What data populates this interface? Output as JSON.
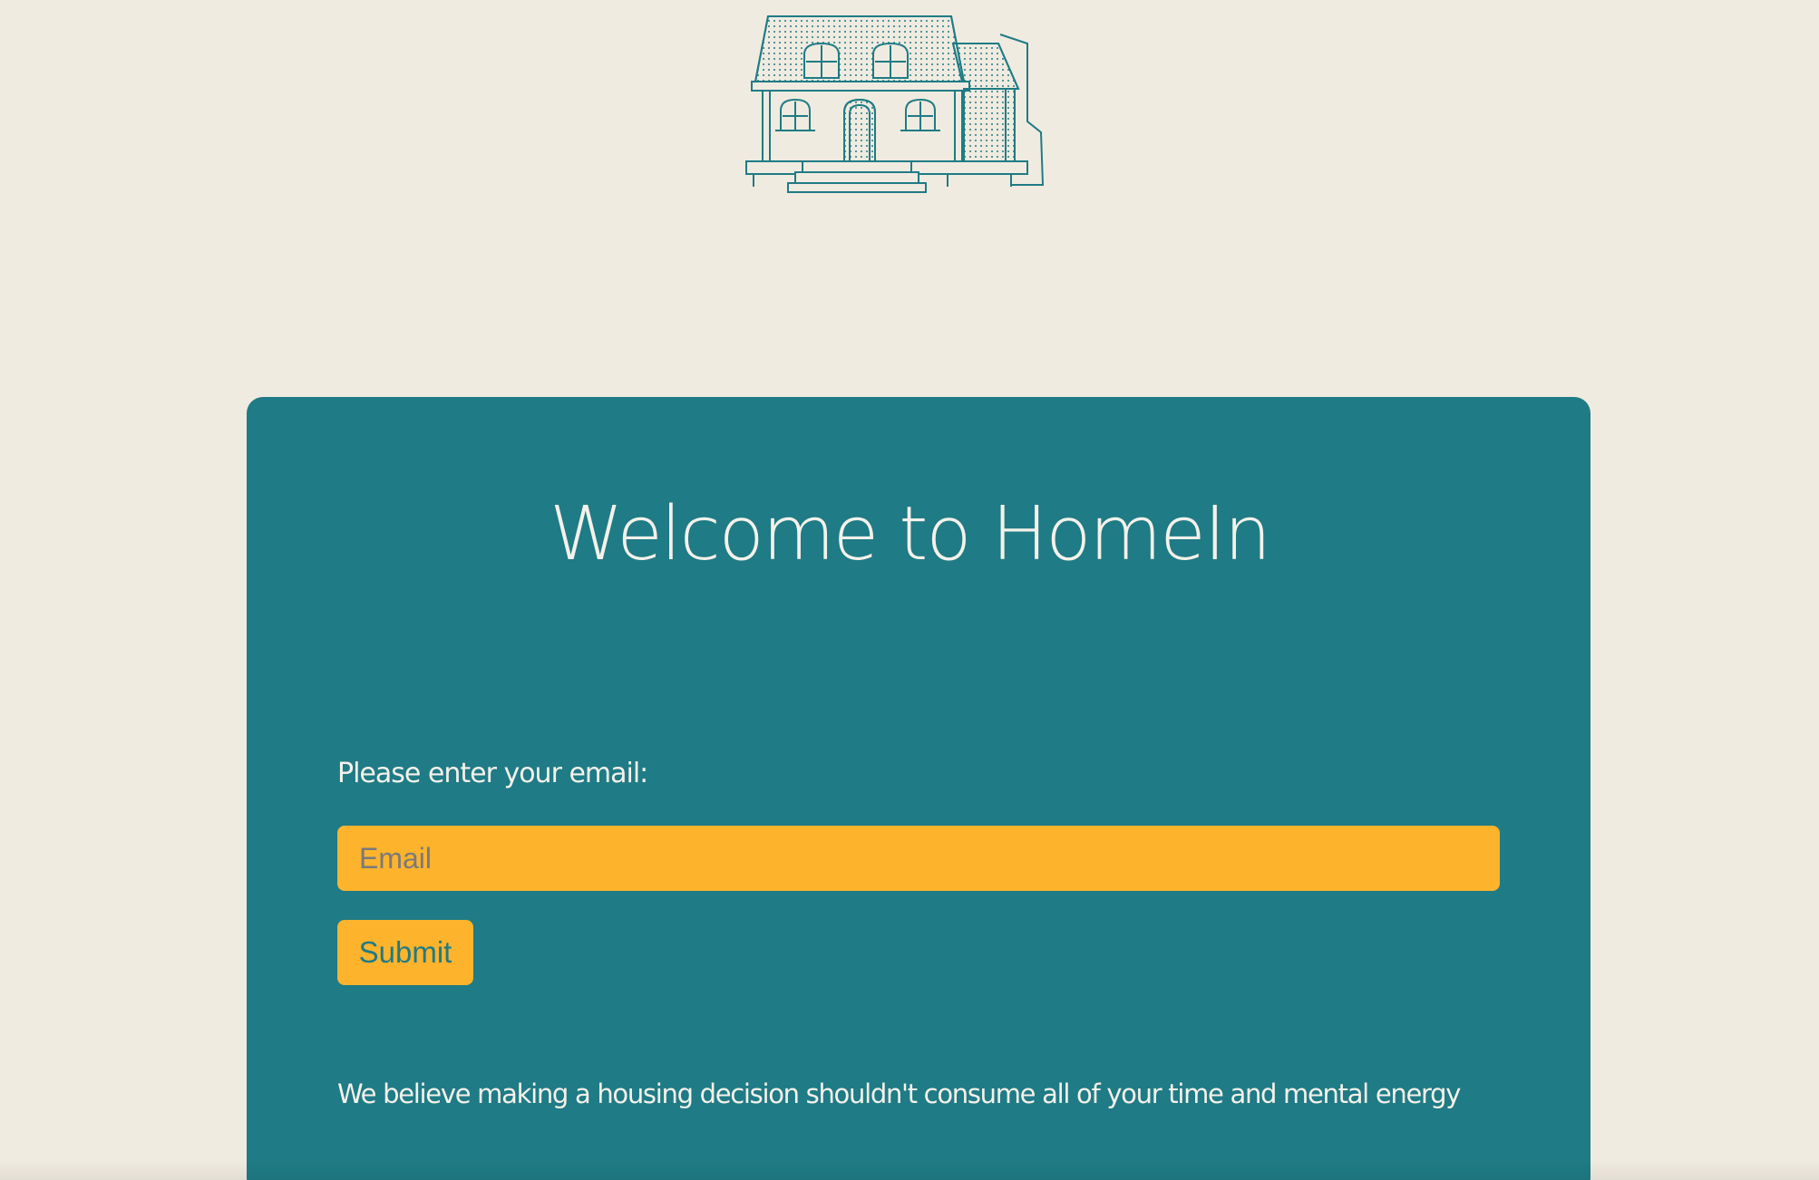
{
  "brand": {
    "logo_icon": "house-illustration-icon",
    "accent_color": "#1F7B85",
    "background_color": "#F0EBE0",
    "button_color": "#FDB32C"
  },
  "welcome": {
    "title": "Welcome to HomeIn"
  },
  "form": {
    "email_label": "Please enter your email:",
    "email_placeholder": "Email",
    "email_value": "",
    "submit_label": "Submit"
  },
  "tagline": "We believe making a housing decision shouldn't consume all of your time and mental energy"
}
